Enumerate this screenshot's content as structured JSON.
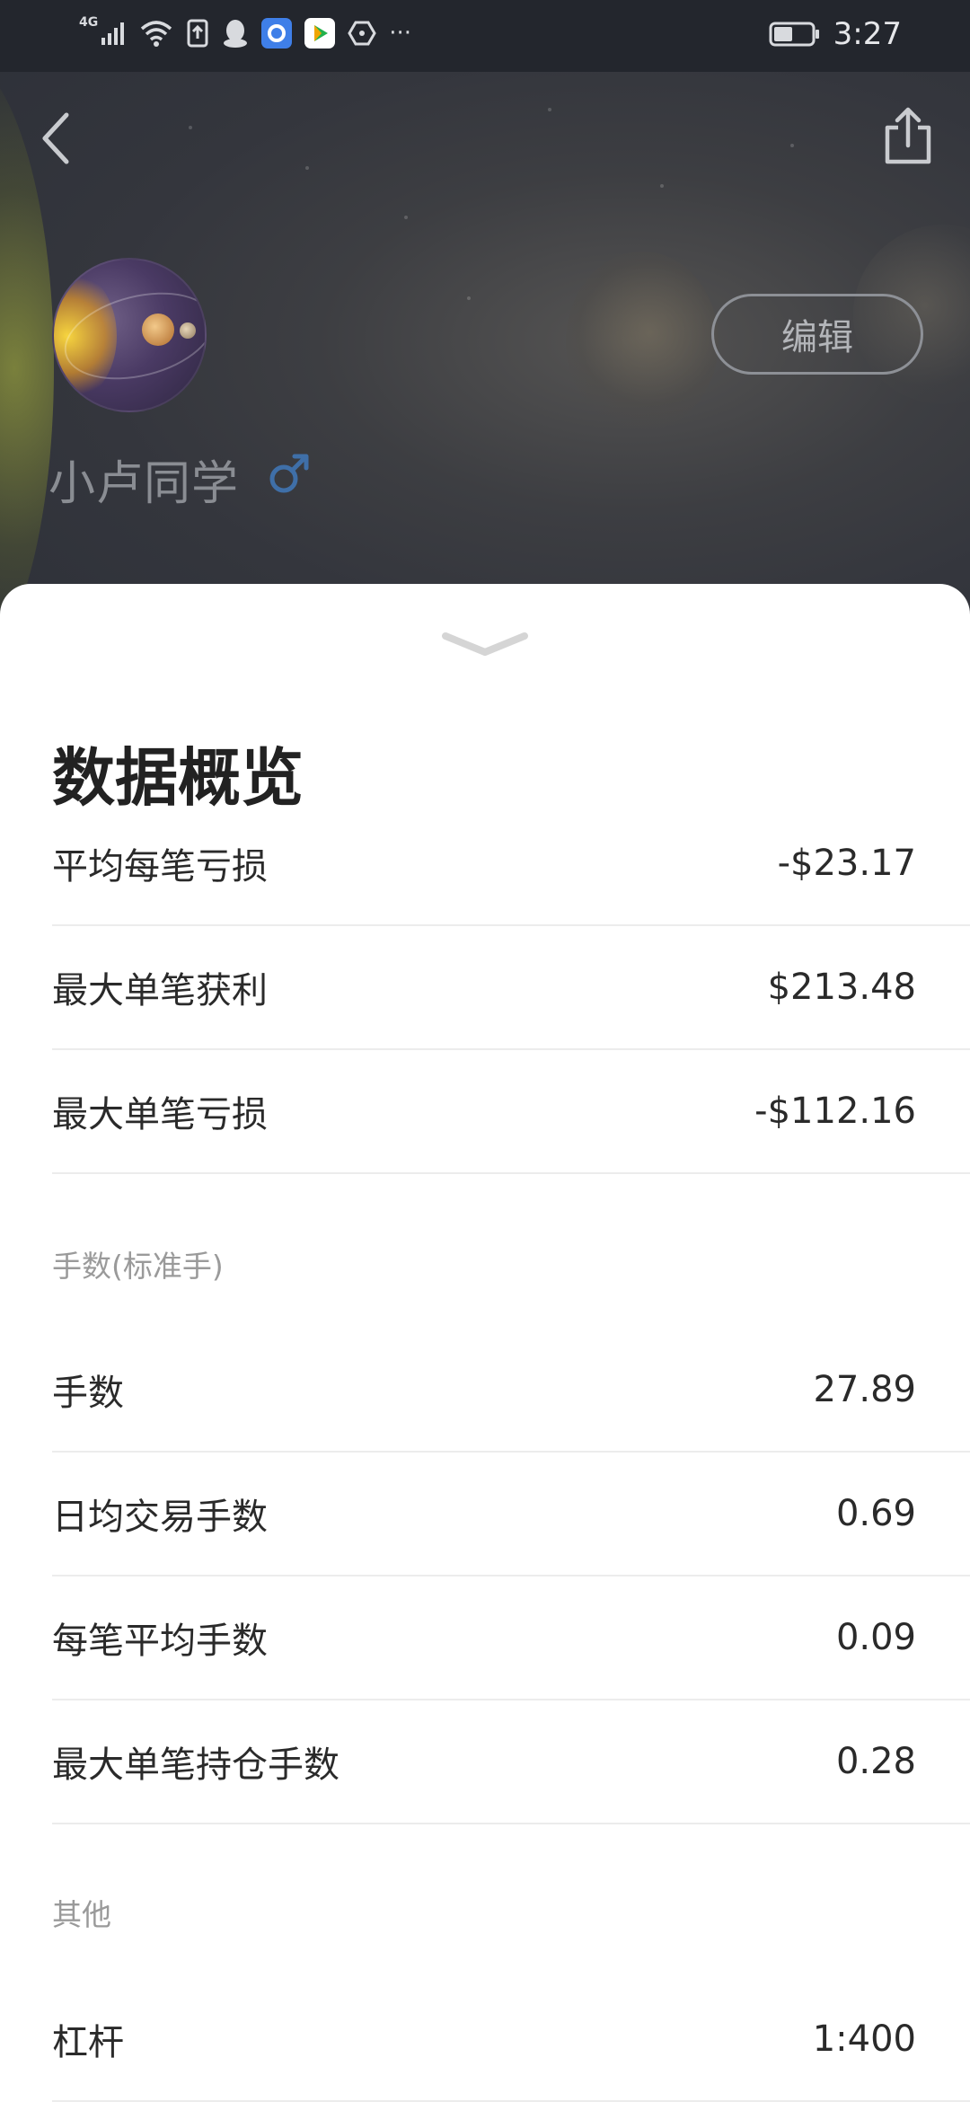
{
  "status_bar": {
    "network": "4G",
    "time": "3:27",
    "more": "···"
  },
  "profile": {
    "username": "小卢同学",
    "gender_symbol": "♂",
    "edit_label": "编辑"
  },
  "sheet": {
    "title": "数据概览",
    "rows_top": [
      {
        "label": "平均每笔亏损",
        "value": "-$23.17"
      },
      {
        "label": "最大单笔获利",
        "value": "$213.48"
      },
      {
        "label": "最大单笔亏损",
        "value": "-$112.16"
      }
    ],
    "section_lots": "手数(标准手)",
    "rows_lots": [
      {
        "label": "手数",
        "value": "27.89"
      },
      {
        "label": "日均交易手数",
        "value": "0.69"
      },
      {
        "label": "每笔平均手数",
        "value": "0.09"
      },
      {
        "label": "最大单笔持仓手数",
        "value": "0.28"
      }
    ],
    "section_other": "其他",
    "rows_other": [
      {
        "label": "杠杆",
        "value": "1:400"
      }
    ]
  },
  "icons": {
    "back": "back-arrow-icon",
    "share": "share-icon",
    "gender": "male-icon",
    "collapse": "chevron-down-icon"
  },
  "colors": {
    "sheet_bg": "#ffffff",
    "header_bg": "#34363d",
    "gender": "#3f6fa8"
  }
}
